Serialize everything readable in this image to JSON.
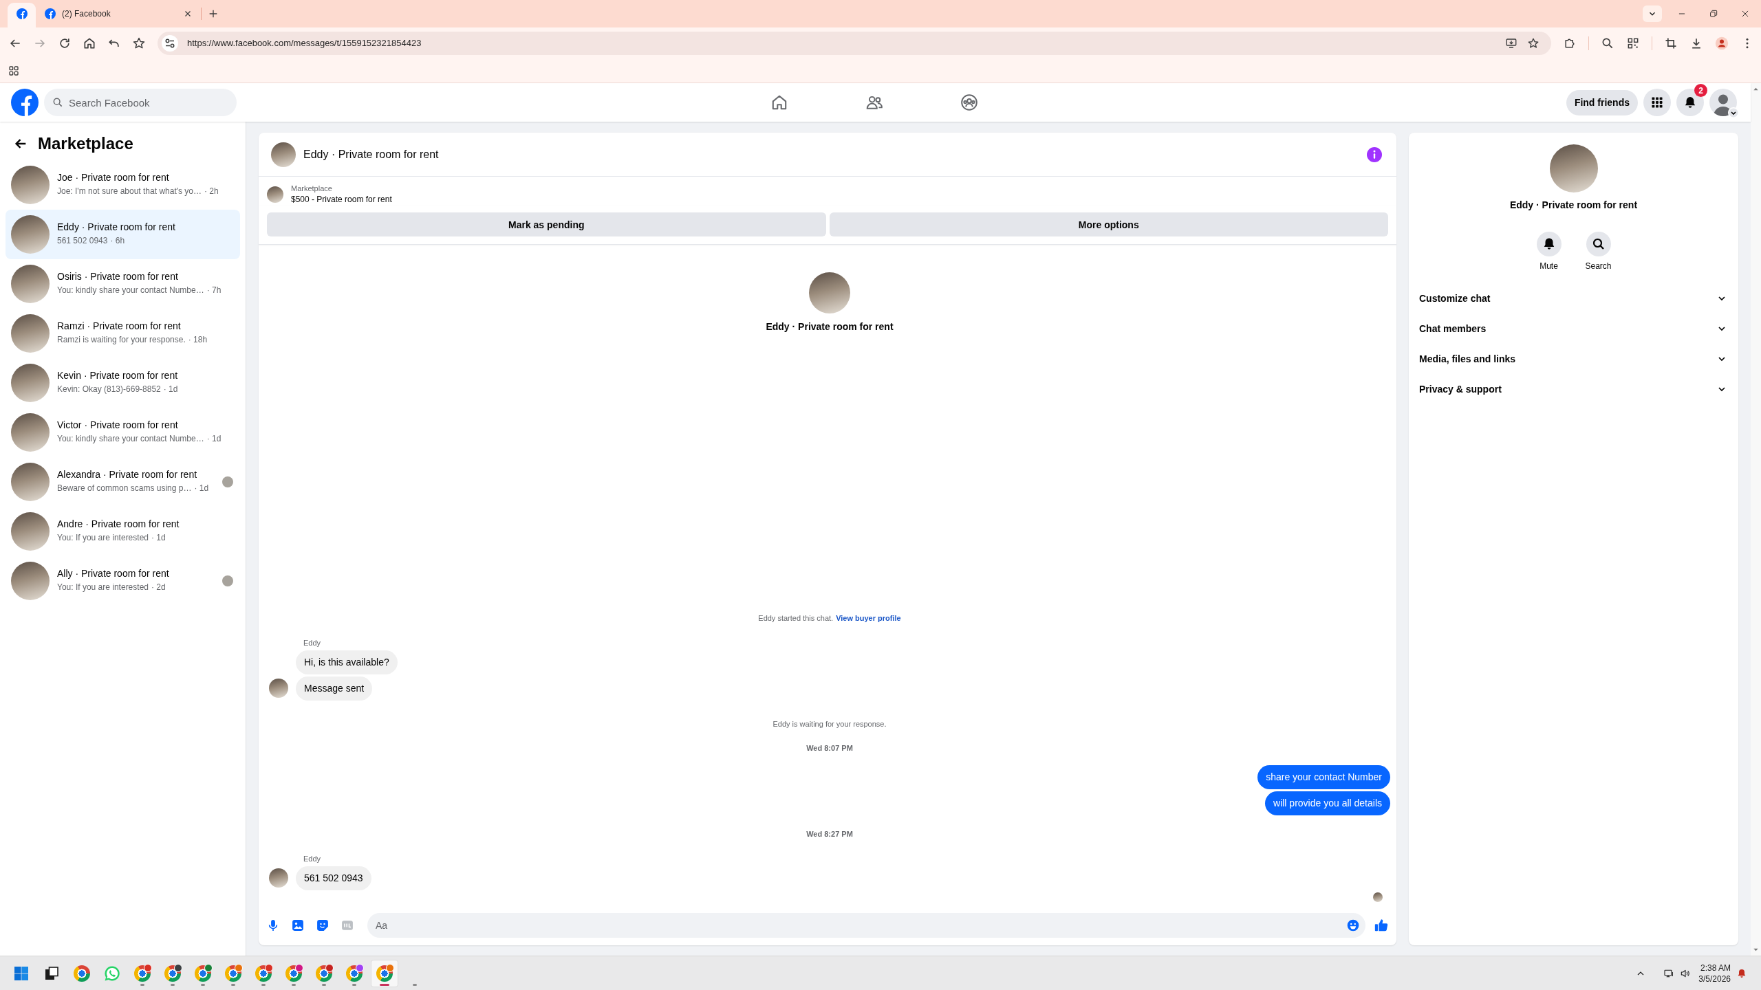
{
  "browser": {
    "tabs": [
      {
        "kind": "pinned",
        "selected": true
      },
      {
        "kind": "normal",
        "title": "(2) Facebook",
        "selected": false
      }
    ],
    "address_bar": {
      "url": "https://www.facebook.com/messages/t/1559152321854423"
    }
  },
  "header": {
    "search": {
      "placeholder": "Search Facebook"
    },
    "nav": [
      {
        "kind": "home",
        "selected": false
      },
      {
        "kind": "friends",
        "selected": false
      },
      {
        "kind": "groups",
        "selected": false
      }
    ],
    "find_friends": "Find friends",
    "notification_count": "2"
  },
  "sidebar": {
    "title": "Marketplace",
    "conversations": [
      {
        "title": "Joe · Private room for rent",
        "preview": "Joe: I'm not sure about that what's yo…",
        "time": "· 2h",
        "selected": false,
        "seen": false
      },
      {
        "title": "Eddy · Private room for rent",
        "preview": "561 502 0943",
        "time": "· 6h",
        "selected": true,
        "seen": false
      },
      {
        "title": "Osiris · Private room for rent",
        "preview": "You: kindly share your contact Numbe…",
        "time": "· 7h",
        "selected": false,
        "seen": false
      },
      {
        "title": "Ramzi · Private room for rent",
        "preview": "Ramzi is waiting for your response.",
        "time": "· 18h",
        "selected": false,
        "seen": false
      },
      {
        "title": "Kevin · Private room for rent",
        "preview": "Kevin: Okay (813)-669-8852",
        "time": "· 1d",
        "selected": false,
        "seen": false
      },
      {
        "title": "Victor · Private room for rent",
        "preview": "You: kindly share your contact Numbe…",
        "time": "· 1d",
        "selected": false,
        "seen": false
      },
      {
        "title": "Alexandra · Private room for rent",
        "preview": "Beware of common scams using p…",
        "time": "· 1d",
        "selected": false,
        "seen": true
      },
      {
        "title": "Andre · Private room for rent",
        "preview": "You: If you are interested",
        "time": "· 1d",
        "selected": false,
        "seen": false
      },
      {
        "title": "Ally · Private room for rent",
        "preview": "You: If you are interested",
        "time": "· 2d",
        "selected": false,
        "seen": true
      }
    ]
  },
  "chat": {
    "title": "Eddy · Private room for rent",
    "listing": {
      "source": "Marketplace",
      "title": "$500 - Private room for rent"
    },
    "actions": [
      "Mark as pending",
      "More options"
    ],
    "profile_title": "Eddy · Private room for rent",
    "messages": [
      {
        "kind": "notice",
        "text": "Eddy started this chat.",
        "link": "View buyer profile"
      },
      {
        "kind": "incoming",
        "sender": "Eddy",
        "bubbles": [
          "Hi, is this available?",
          "Message sent"
        ]
      },
      {
        "kind": "notice",
        "text": "Eddy is waiting for your response."
      },
      {
        "kind": "timestamp",
        "text": "Wed 8:07 PM"
      },
      {
        "kind": "outgoing",
        "bubbles": [
          "share your contact Number",
          "will provide you all details"
        ]
      },
      {
        "kind": "timestamp",
        "text": "Wed 8:27 PM"
      },
      {
        "kind": "incoming",
        "sender": "Eddy",
        "bubbles": [
          "561 502 0943"
        ]
      }
    ],
    "read_receipt": true,
    "composer": {
      "placeholder": "Aa"
    }
  },
  "details": {
    "title": "Eddy · Private room for rent",
    "actions": [
      {
        "kind": "mute",
        "label": "Mute"
      },
      {
        "kind": "search",
        "label": "Search"
      }
    ],
    "sections": [
      {
        "label": "Customize chat",
        "expanded": false
      },
      {
        "label": "Chat members",
        "expanded": false
      },
      {
        "label": "Media, files and links",
        "expanded": false
      },
      {
        "label": "Privacy & support",
        "expanded": false
      }
    ]
  },
  "taskbar": {
    "apps": [
      {
        "kind": "start",
        "running": false,
        "selected": false
      },
      {
        "kind": "task_view",
        "running": false,
        "selected": false
      },
      {
        "kind": "browser",
        "running": false,
        "selected": false
      },
      {
        "kind": "whatsapp",
        "running": false,
        "selected": false
      },
      {
        "kind": "browser_profile",
        "color": "#d93025",
        "running": true,
        "selected": false
      },
      {
        "kind": "browser_profile",
        "color": "#3c4043",
        "running": true,
        "selected": false
      },
      {
        "kind": "browser_profile",
        "color": "#188038",
        "running": true,
        "selected": false
      },
      {
        "kind": "browser_profile",
        "color": "#e8710a",
        "running": true,
        "selected": false
      },
      {
        "kind": "browser_profile",
        "color": "#d93025",
        "running": true,
        "selected": false
      },
      {
        "kind": "browser_profile",
        "color": "#d01884",
        "running": true,
        "selected": false
      },
      {
        "kind": "browser_profile",
        "color": "#c5221f",
        "running": true,
        "selected": false
      },
      {
        "kind": "browser_profile",
        "color": "#a142f4",
        "running": true,
        "selected": false
      },
      {
        "kind": "browser_profile",
        "color": "#e8710a",
        "running": true,
        "selected": true
      },
      {
        "kind": "blank",
        "running": true,
        "selected": false
      }
    ],
    "time": "2:38 AM",
    "date": "3/5/2026"
  }
}
